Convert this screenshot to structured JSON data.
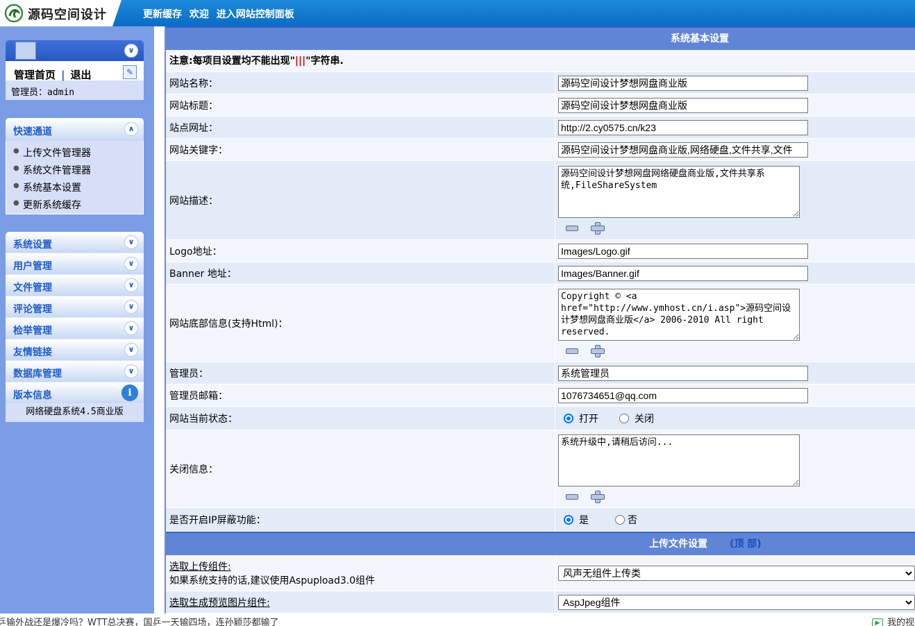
{
  "header": {
    "logo_text": "源码空间设计",
    "nav": [
      "更新缓存",
      "欢迎",
      "进入网站控制面板"
    ]
  },
  "sidebar": {
    "admin": {
      "home_link": "管理首页",
      "separator": "|",
      "logout_link": "退出",
      "user_label": "管理员：admin"
    },
    "quick": {
      "title": "快速通道",
      "items": [
        "上传文件管理器",
        "系统文件管理器",
        "系统基本设置",
        "更新系统缓存"
      ]
    },
    "menu": [
      "系统设置",
      "用户管理",
      "文件管理",
      "评论管理",
      "检举管理",
      "友情链接",
      "数据库管理"
    ],
    "version": {
      "title": "版本信息",
      "text": "网络硬盘系统4.5商业版"
    }
  },
  "main": {
    "section1": {
      "title": "系统基本设置",
      "notice_prefix": "注意:每项目设置均不能出现\"",
      "notice_mark": "|||",
      "notice_suffix": "\"字符串."
    },
    "fields": {
      "site_name": {
        "label": "网站名称：",
        "value": "源码空间设计梦想网盘商业版"
      },
      "site_title": {
        "label": "网站标题：",
        "value": "源码空间设计梦想网盘商业版"
      },
      "site_url": {
        "label": "站点网址：",
        "value": "http://2.cy0575.cn/k23"
      },
      "keywords": {
        "label": "网站关键字：",
        "value": "源码空间设计梦想网盘商业版,网络硬盘,文件共享,文件"
      },
      "description": {
        "label": "网站描述：",
        "value": "源码空间设计梦想网盘网络硬盘商业版,文件共享系统,FileShareSystem"
      },
      "logo": {
        "label": "Logo地址：",
        "value": "Images/Logo.gif"
      },
      "banner": {
        "label": "Banner 地址：",
        "value": "Images/Banner.gif"
      },
      "footer": {
        "label": "网站底部信息(支持Html)：",
        "value": "Copyright © <a href=\"http://www.ymhost.cn/i.asp\">源码空间设计梦想网盘商业版</a> 2006-2010 All right reserved."
      },
      "admin_name": {
        "label": "管理员：",
        "value": "系统管理员"
      },
      "admin_email": {
        "label": "管理员邮箱：",
        "value": "1076734651@qq.com"
      },
      "site_status": {
        "label": "网站当前状态：",
        "opt_on": "打开",
        "opt_off": "关闭",
        "selected": "打开"
      },
      "close_msg": {
        "label": "关闭信息：",
        "value": "系统升级中,请稍后访问..."
      },
      "ip_block": {
        "label": "是否开启IP屏蔽功能：",
        "opt_yes": "是",
        "opt_no": "否",
        "selected": "是"
      }
    },
    "section2": {
      "title": "上传文件设置",
      "top_link": "(顶 部)"
    },
    "upload": {
      "component": {
        "label": "选取上传组件:",
        "hint": "如果系统支持的话,建议使用Aspupload3.0组件",
        "value": "风声无组件上传类"
      },
      "preview": {
        "label": "选取生成预览图片组件:",
        "value": "AspJpeg组件"
      }
    }
  },
  "bottombar": {
    "left_text": "乒输外战还是爆冷吗？WTT总决赛，国乒一天输四场，连孙颖莎都输了",
    "right_text": "我的视频"
  },
  "colors": {
    "topbar": "#0a6cc6",
    "sidebar": "#7a9de6",
    "section_header": "#6185d6",
    "link_blue": "#215dc6",
    "notice_red": "#dd0000"
  }
}
